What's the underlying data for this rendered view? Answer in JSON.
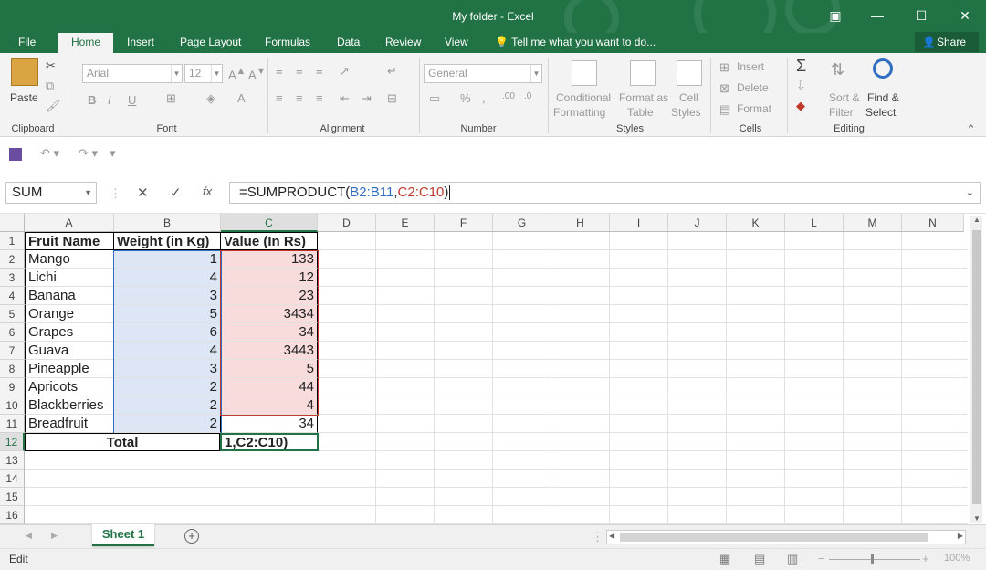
{
  "window": {
    "title": "My folder - Excel"
  },
  "tabs": [
    "File",
    "Home",
    "Insert",
    "Page Layout",
    "Formulas",
    "Data",
    "Review",
    "View"
  ],
  "tell_me": "Tell me what you want to do...",
  "share_label": "Share",
  "ribbon": {
    "clipboard": {
      "label": "Clipboard",
      "paste": "Paste"
    },
    "font": {
      "label": "Font",
      "family": "Arial",
      "size": "12"
    },
    "alignment": {
      "label": "Alignment"
    },
    "number": {
      "label": "Number",
      "format": "General"
    },
    "styles": {
      "label": "Styles",
      "cond1": "Conditional",
      "cond2": "Formatting",
      "fmt1": "Format as",
      "fmt2": "Table",
      "cell1": "Cell",
      "cell2": "Styles"
    },
    "cells": {
      "label": "Cells",
      "insert": "Insert",
      "delete": "Delete",
      "format": "Format"
    },
    "editing": {
      "label": "Editing",
      "sort1": "Sort &",
      "sort2": "Filter",
      "find1": "Find &",
      "find2": "Select"
    }
  },
  "namebox": "SUM",
  "formula": {
    "prefix": "=SUMPRODUCT(",
    "ref1": "B2:B11",
    "comma": ",",
    "ref2": "C2:C10",
    "suffix": ")"
  },
  "columns": [
    "A",
    "B",
    "C",
    "D",
    "E",
    "F",
    "G",
    "H",
    "I",
    "J",
    "K",
    "L",
    "M",
    "N"
  ],
  "rows": [
    "1",
    "2",
    "3",
    "4",
    "5",
    "6",
    "7",
    "8",
    "9",
    "10",
    "11",
    "12",
    "13",
    "14",
    "15",
    "16"
  ],
  "table": {
    "headers": [
      "Fruit Name",
      "Weight (in Kg)",
      "Value (In Rs)"
    ],
    "data": [
      [
        "Mango",
        "1",
        "133"
      ],
      [
        "Lichi",
        "4",
        "12"
      ],
      [
        "Banana",
        "3",
        "23"
      ],
      [
        "Orange",
        "5",
        "3434"
      ],
      [
        "Grapes",
        "6",
        "34"
      ],
      [
        "Guava",
        "4",
        "3443"
      ],
      [
        "Pineapple",
        "3",
        "5"
      ],
      [
        "Apricots",
        "2",
        "44"
      ],
      [
        "Blackberries",
        "2",
        "4"
      ],
      [
        "Breadfruit",
        "2",
        "34"
      ]
    ],
    "total_label": "Total",
    "editing_text": "1,C2:C10)"
  },
  "sheet_tab": "Sheet 1",
  "status": {
    "mode": "Edit",
    "zoom": "100%"
  },
  "colors": {
    "brand": "#217346",
    "ref1": "#2f6ec0",
    "ref2": "#c0392b"
  }
}
